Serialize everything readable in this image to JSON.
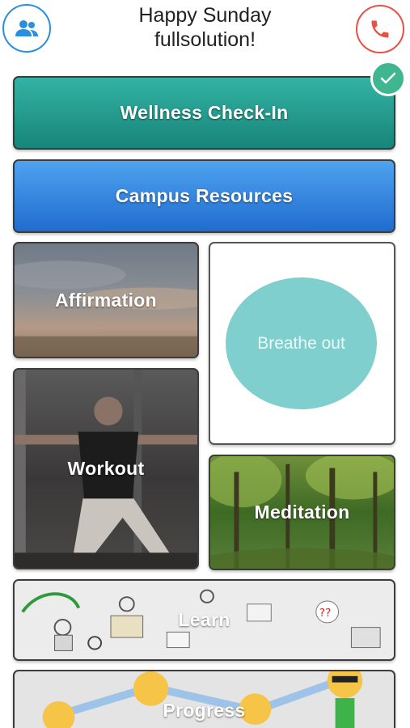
{
  "header": {
    "greeting_line1": "Happy Sunday",
    "greeting_line2": "fullsolution!",
    "left_icon": "friends-icon",
    "right_icon": "phone-icon"
  },
  "cards": {
    "wellness": {
      "label": "Wellness Check-In",
      "badge_icon": "checkmark-icon",
      "completed": true
    },
    "campus": {
      "label": "Campus Resources"
    },
    "affirmation": {
      "label": "Affirmation"
    },
    "breathe": {
      "label": "Breathe out"
    },
    "workout": {
      "label": "Workout"
    },
    "meditation": {
      "label": "Meditation"
    },
    "learn": {
      "label": "Learn"
    },
    "progress": {
      "label": "Progress"
    }
  },
  "colors": {
    "friends_accent": "#2b8fe0",
    "call_accent": "#e85144",
    "wellness": "#1f9a8c",
    "campus": "#2f80dd",
    "breathe_circle": "#7fcfcf",
    "check_badge": "#3fb68f"
  }
}
